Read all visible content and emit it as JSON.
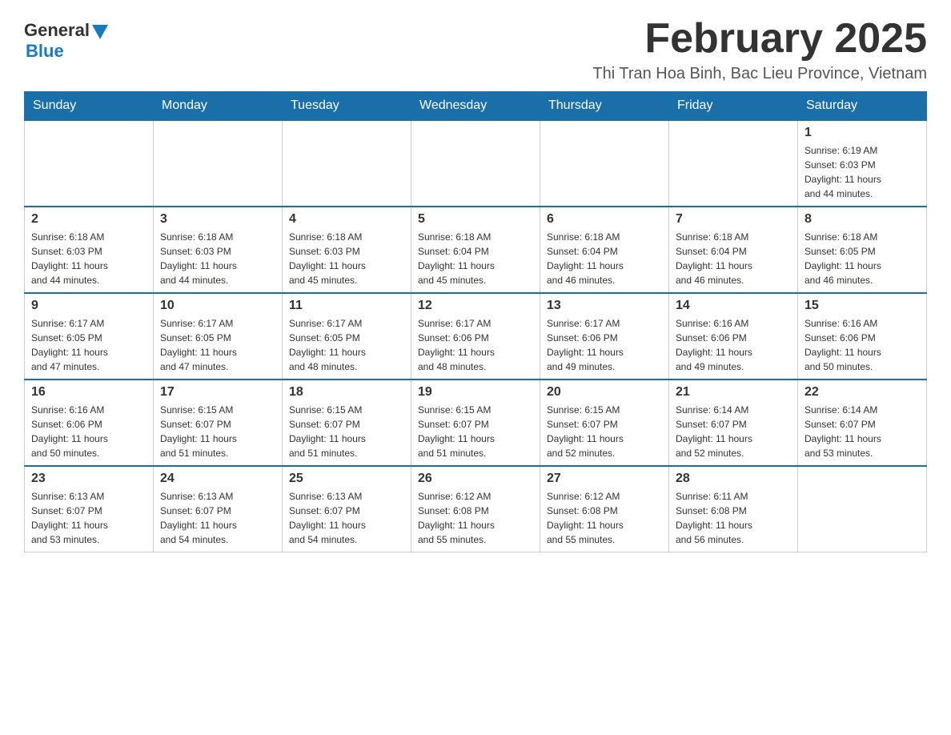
{
  "logo": {
    "general": "General",
    "blue": "Blue"
  },
  "title": "February 2025",
  "subtitle": "Thi Tran Hoa Binh, Bac Lieu Province, Vietnam",
  "weekdays": [
    "Sunday",
    "Monday",
    "Tuesday",
    "Wednesday",
    "Thursday",
    "Friday",
    "Saturday"
  ],
  "weeks": [
    [
      {
        "day": "",
        "info": ""
      },
      {
        "day": "",
        "info": ""
      },
      {
        "day": "",
        "info": ""
      },
      {
        "day": "",
        "info": ""
      },
      {
        "day": "",
        "info": ""
      },
      {
        "day": "",
        "info": ""
      },
      {
        "day": "1",
        "info": "Sunrise: 6:19 AM\nSunset: 6:03 PM\nDaylight: 11 hours\nand 44 minutes."
      }
    ],
    [
      {
        "day": "2",
        "info": "Sunrise: 6:18 AM\nSunset: 6:03 PM\nDaylight: 11 hours\nand 44 minutes."
      },
      {
        "day": "3",
        "info": "Sunrise: 6:18 AM\nSunset: 6:03 PM\nDaylight: 11 hours\nand 44 minutes."
      },
      {
        "day": "4",
        "info": "Sunrise: 6:18 AM\nSunset: 6:03 PM\nDaylight: 11 hours\nand 45 minutes."
      },
      {
        "day": "5",
        "info": "Sunrise: 6:18 AM\nSunset: 6:04 PM\nDaylight: 11 hours\nand 45 minutes."
      },
      {
        "day": "6",
        "info": "Sunrise: 6:18 AM\nSunset: 6:04 PM\nDaylight: 11 hours\nand 46 minutes."
      },
      {
        "day": "7",
        "info": "Sunrise: 6:18 AM\nSunset: 6:04 PM\nDaylight: 11 hours\nand 46 minutes."
      },
      {
        "day": "8",
        "info": "Sunrise: 6:18 AM\nSunset: 6:05 PM\nDaylight: 11 hours\nand 46 minutes."
      }
    ],
    [
      {
        "day": "9",
        "info": "Sunrise: 6:17 AM\nSunset: 6:05 PM\nDaylight: 11 hours\nand 47 minutes."
      },
      {
        "day": "10",
        "info": "Sunrise: 6:17 AM\nSunset: 6:05 PM\nDaylight: 11 hours\nand 47 minutes."
      },
      {
        "day": "11",
        "info": "Sunrise: 6:17 AM\nSunset: 6:05 PM\nDaylight: 11 hours\nand 48 minutes."
      },
      {
        "day": "12",
        "info": "Sunrise: 6:17 AM\nSunset: 6:06 PM\nDaylight: 11 hours\nand 48 minutes."
      },
      {
        "day": "13",
        "info": "Sunrise: 6:17 AM\nSunset: 6:06 PM\nDaylight: 11 hours\nand 49 minutes."
      },
      {
        "day": "14",
        "info": "Sunrise: 6:16 AM\nSunset: 6:06 PM\nDaylight: 11 hours\nand 49 minutes."
      },
      {
        "day": "15",
        "info": "Sunrise: 6:16 AM\nSunset: 6:06 PM\nDaylight: 11 hours\nand 50 minutes."
      }
    ],
    [
      {
        "day": "16",
        "info": "Sunrise: 6:16 AM\nSunset: 6:06 PM\nDaylight: 11 hours\nand 50 minutes."
      },
      {
        "day": "17",
        "info": "Sunrise: 6:15 AM\nSunset: 6:07 PM\nDaylight: 11 hours\nand 51 minutes."
      },
      {
        "day": "18",
        "info": "Sunrise: 6:15 AM\nSunset: 6:07 PM\nDaylight: 11 hours\nand 51 minutes."
      },
      {
        "day": "19",
        "info": "Sunrise: 6:15 AM\nSunset: 6:07 PM\nDaylight: 11 hours\nand 51 minutes."
      },
      {
        "day": "20",
        "info": "Sunrise: 6:15 AM\nSunset: 6:07 PM\nDaylight: 11 hours\nand 52 minutes."
      },
      {
        "day": "21",
        "info": "Sunrise: 6:14 AM\nSunset: 6:07 PM\nDaylight: 11 hours\nand 52 minutes."
      },
      {
        "day": "22",
        "info": "Sunrise: 6:14 AM\nSunset: 6:07 PM\nDaylight: 11 hours\nand 53 minutes."
      }
    ],
    [
      {
        "day": "23",
        "info": "Sunrise: 6:13 AM\nSunset: 6:07 PM\nDaylight: 11 hours\nand 53 minutes."
      },
      {
        "day": "24",
        "info": "Sunrise: 6:13 AM\nSunset: 6:07 PM\nDaylight: 11 hours\nand 54 minutes."
      },
      {
        "day": "25",
        "info": "Sunrise: 6:13 AM\nSunset: 6:07 PM\nDaylight: 11 hours\nand 54 minutes."
      },
      {
        "day": "26",
        "info": "Sunrise: 6:12 AM\nSunset: 6:08 PM\nDaylight: 11 hours\nand 55 minutes."
      },
      {
        "day": "27",
        "info": "Sunrise: 6:12 AM\nSunset: 6:08 PM\nDaylight: 11 hours\nand 55 minutes."
      },
      {
        "day": "28",
        "info": "Sunrise: 6:11 AM\nSunset: 6:08 PM\nDaylight: 11 hours\nand 56 minutes."
      },
      {
        "day": "",
        "info": ""
      }
    ]
  ]
}
